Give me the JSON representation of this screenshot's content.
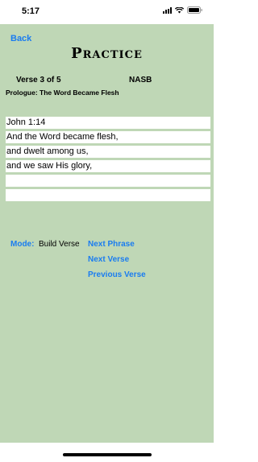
{
  "status_bar": {
    "time": "5:17",
    "icons": [
      "signal-icon",
      "wifi-icon",
      "battery-icon"
    ]
  },
  "nav": {
    "back_label": "Back"
  },
  "header": {
    "title": "Practice",
    "verse_counter": "Verse 3 of 5",
    "translation": "NASB",
    "passage_title": "Prologue: The Word Became Flesh"
  },
  "verse": {
    "lines": [
      "John 1:14",
      "And the Word became flesh,",
      "and dwelt among us,",
      "and we saw His glory,",
      "",
      ""
    ]
  },
  "mode": {
    "label": "Mode:",
    "value": "Build Verse"
  },
  "actions": {
    "next_phrase": "Next Phrase",
    "next_verse": "Next Verse",
    "previous_verse": "Previous Verse"
  },
  "colors": {
    "background": "#bfd7b6",
    "accent": "#1a7cf0"
  }
}
